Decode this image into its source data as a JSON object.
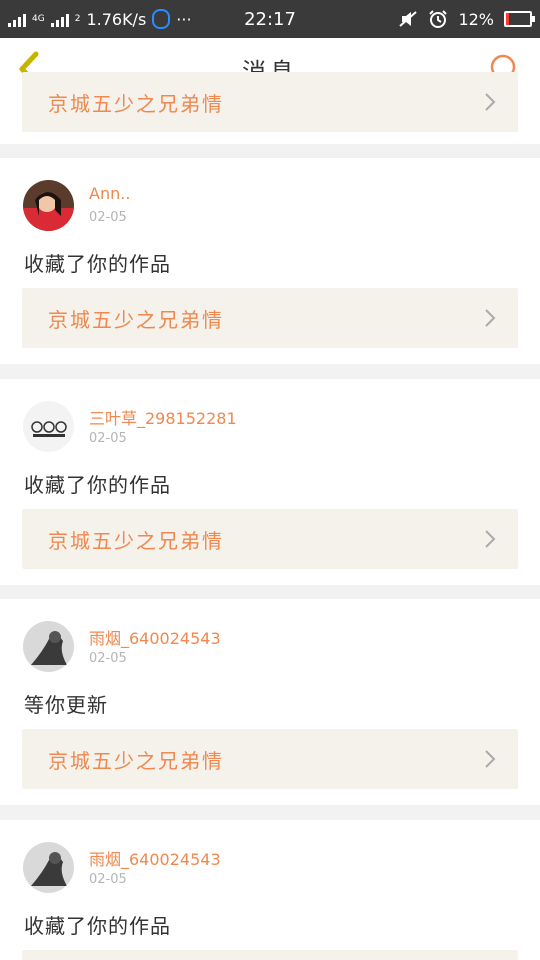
{
  "status_bar": {
    "network": "4G",
    "sim_slot": "2",
    "speed": "1.76K/s",
    "more": "···",
    "time": "22:17",
    "battery_pct": "12%",
    "battery_level": 0.12,
    "battery_color": "#ff3b30"
  },
  "header": {
    "title": "消息",
    "back_icon": "chevron-left-icon",
    "search_icon": "search-icon"
  },
  "accent_color": "#f0884f",
  "partial_item": {
    "work_title": "京城五少之兄弟情"
  },
  "messages": [
    {
      "user": "Ann..",
      "date": "02-05",
      "action": "收藏了你的作品",
      "work_title": "京城五少之兄弟情"
    },
    {
      "user": "三叶草_298152281",
      "date": "02-05",
      "action": "收藏了你的作品",
      "work_title": "京城五少之兄弟情"
    },
    {
      "user": "雨烟_640024543",
      "date": "02-05",
      "action": "等你更新",
      "work_title": "京城五少之兄弟情"
    },
    {
      "user": "雨烟_640024543",
      "date": "02-05",
      "action": "收藏了你的作品",
      "work_title": ""
    }
  ]
}
